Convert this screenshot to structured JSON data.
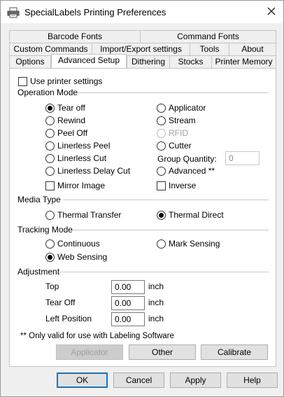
{
  "window": {
    "title": "SpecialLabels Printing Preferences"
  },
  "tabs": {
    "row1": [
      "Barcode Fonts",
      "Command Fonts"
    ],
    "row2": [
      "Custom Commands",
      "Import/Export settings",
      "Tools",
      "About"
    ],
    "row3": [
      "Options",
      "Advanced Setup",
      "Dithering",
      "Stocks",
      "Printer Memory"
    ],
    "active": "Advanced Setup"
  },
  "use_printer_settings": {
    "label": "Use printer settings",
    "checked": false
  },
  "operation_mode": {
    "title": "Operation Mode",
    "left": [
      {
        "label": "Tear off",
        "checked": true
      },
      {
        "label": "Rewind",
        "checked": false
      },
      {
        "label": "Peel Off",
        "checked": false
      },
      {
        "label": "Linerless Peel",
        "checked": false
      },
      {
        "label": "Linerless Cut",
        "checked": false
      },
      {
        "label": "Linerless Delay Cut",
        "checked": false
      }
    ],
    "right": [
      {
        "label": "Applicator",
        "checked": false
      },
      {
        "label": "Stream",
        "checked": false
      },
      {
        "label": "RFID",
        "checked": false,
        "disabled": true
      },
      {
        "label": "Cutter",
        "checked": false
      }
    ],
    "group_quantity_label": "Group Quantity:",
    "group_quantity_value": "0",
    "advanced_label": "Advanced **",
    "mirror_image_label": "Mirror Image",
    "inverse_label": "Inverse"
  },
  "media_type": {
    "title": "Media Type",
    "thermal_transfer": "Thermal Transfer",
    "thermal_direct": "Thermal Direct",
    "selected": "Thermal Direct"
  },
  "tracking_mode": {
    "title": "Tracking Mode",
    "continuous": "Continuous",
    "mark_sensing": "Mark Sensing",
    "web_sensing": "Web Sensing",
    "selected": "Web Sensing"
  },
  "adjustment": {
    "title": "Adjustment",
    "rows": [
      {
        "label": "Top",
        "value": "0.00",
        "unit": "inch"
      },
      {
        "label": "Tear Off",
        "value": "0.00",
        "unit": "inch"
      },
      {
        "label": "Left Position",
        "value": "0.00",
        "unit": "inch"
      }
    ]
  },
  "footnote": "** Only valid for use with Labeling Software",
  "panel_buttons": {
    "applicator": "Applicator",
    "other": "Other",
    "calibrate": "Calibrate"
  },
  "dialog_buttons": {
    "ok": "OK",
    "cancel": "Cancel",
    "apply": "Apply",
    "help": "Help"
  },
  "icons": {
    "app": "printer-icon",
    "close": "close-icon"
  }
}
